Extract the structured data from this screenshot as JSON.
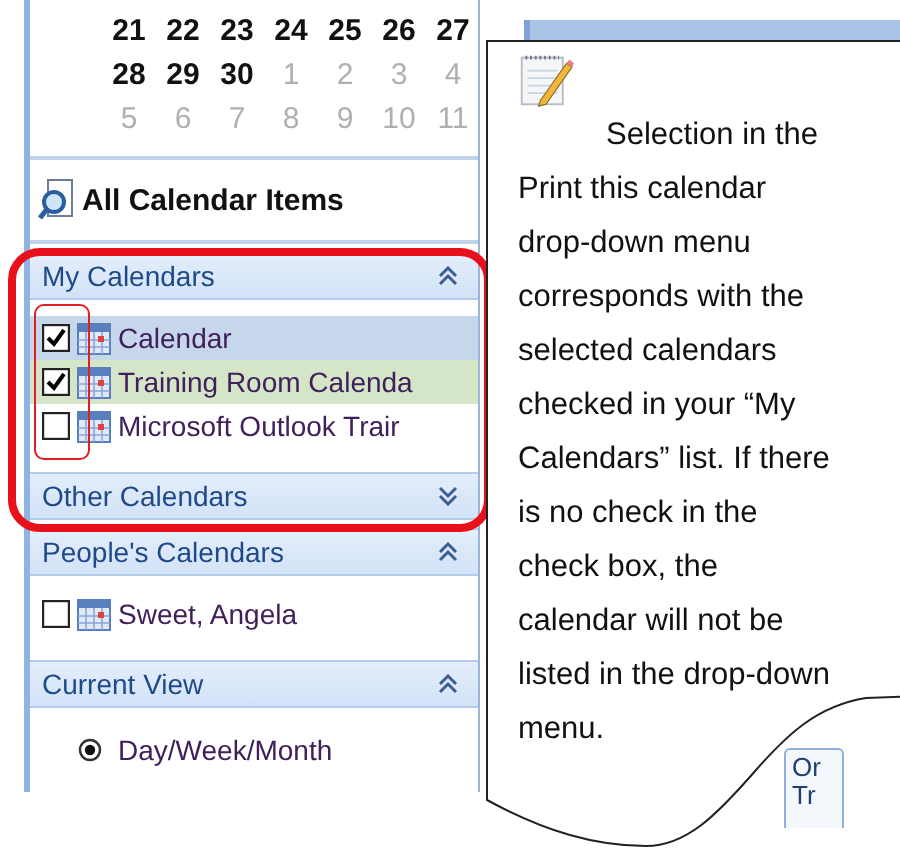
{
  "mini_calendar": {
    "weeks": [
      [
        {
          "day": "21",
          "current": true
        },
        {
          "day": "22",
          "current": true
        },
        {
          "day": "23",
          "current": true
        },
        {
          "day": "24",
          "current": true
        },
        {
          "day": "25",
          "current": true
        },
        {
          "day": "26",
          "current": true
        },
        {
          "day": "27",
          "current": true
        }
      ],
      [
        {
          "day": "28",
          "current": true
        },
        {
          "day": "29",
          "current": true
        },
        {
          "day": "30",
          "current": true
        },
        {
          "day": "1",
          "current": false
        },
        {
          "day": "2",
          "current": false
        },
        {
          "day": "3",
          "current": false
        },
        {
          "day": "4",
          "current": false
        }
      ],
      [
        {
          "day": "5",
          "current": false
        },
        {
          "day": "6",
          "current": false
        },
        {
          "day": "7",
          "current": false
        },
        {
          "day": "8",
          "current": false
        },
        {
          "day": "9",
          "current": false
        },
        {
          "day": "10",
          "current": false
        },
        {
          "day": "11",
          "current": false
        }
      ]
    ]
  },
  "all_items": {
    "label": "All Calendar Items"
  },
  "sections": [
    {
      "title": "My Calendars",
      "expanded": true,
      "kind": "calendars",
      "items": [
        {
          "label": "Calendar",
          "checked": true,
          "color": "#c6d7ec"
        },
        {
          "label": "Training Room Calenda",
          "checked": true,
          "color": "#d5e5c8"
        },
        {
          "label": "Microsoft Outlook Trair",
          "checked": false,
          "color": "#ffffff"
        }
      ]
    },
    {
      "title": "Other Calendars",
      "expanded": false
    },
    {
      "title": "People's Calendars",
      "expanded": true,
      "kind": "calendars",
      "items": [
        {
          "label": "Sweet, Angela",
          "checked": false,
          "color": "#ffffff"
        }
      ]
    },
    {
      "title": "Current View",
      "expanded": true,
      "kind": "views",
      "items": [
        {
          "label": "Day/Week/Month",
          "selected": true
        }
      ]
    }
  ],
  "callout": {
    "text": "Selection in the Print this calendar drop-down menu corresponds with the selected calendars checked in your “My Calendars” list.  If there is no check in the check box, the calendar will not be listed in the drop-down menu."
  },
  "background_tab": {
    "lines": [
      "Or",
      "Tr"
    ]
  }
}
